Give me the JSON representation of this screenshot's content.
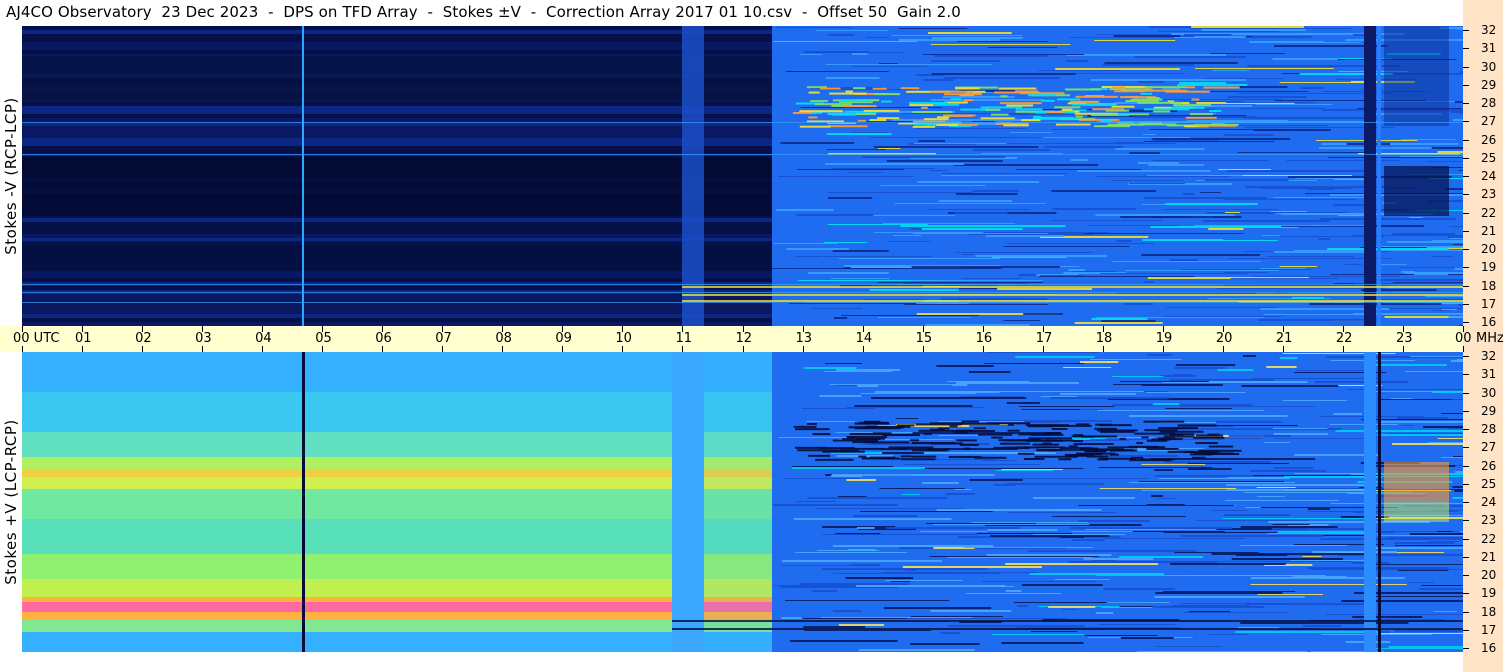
{
  "title": "AJ4CO Observatory  23 Dec 2023  -  DPS on TFD Array  -  Stokes ±V  -  Correction Array 2017 01 10.csv  -  Offset 50  Gain 2.0",
  "panels": {
    "top": {
      "ylabel": "Stokes -V (RCP-LCP)",
      "colormap": "jet-dark"
    },
    "bottom": {
      "ylabel": "Stokes +V (LCP-RCP)",
      "colormap": "jet-bright"
    }
  },
  "time_axis": {
    "labels": [
      "00 UTC",
      "01",
      "02",
      "03",
      "04",
      "05",
      "06",
      "07",
      "08",
      "09",
      "10",
      "11",
      "12",
      "13",
      "14",
      "15",
      "16",
      "17",
      "18",
      "19",
      "20",
      "21",
      "22",
      "23",
      "00"
    ],
    "unit": "MHz"
  },
  "freq_axis": {
    "labels": [
      "32",
      "31",
      "30",
      "29",
      "28",
      "27",
      "26",
      "25",
      "24",
      "23",
      "22",
      "21",
      "20",
      "19",
      "18",
      "17",
      "16"
    ]
  },
  "colors": {
    "time_strip": "#ffffd0",
    "right_strip": "#ffe4c8",
    "dark_bg": "#050c3a",
    "medium_blue": "#1f6cf0",
    "light_blue": "#3aa0ff",
    "cyan": "#00e0f0",
    "green": "#7ee060",
    "yellow": "#f0e030",
    "orange": "#ff9a30",
    "magenta": "#ff50a0"
  },
  "chart_data": {
    "type": "heatmap",
    "title": "AJ4CO Observatory  23 Dec 2023  -  DPS on TFD Array  -  Stokes ±V  -  Correction Array 2017 01 10.csv  -  Offset 50  Gain 2.0",
    "x_range": [
      "00 UTC",
      "00"
    ],
    "y_range_mhz": [
      16,
      32
    ],
    "grid": false,
    "panels": [
      {
        "name": "Stokes -V (RCP-LCP)"
      },
      {
        "name": "Stokes +V (LCP-RCP)"
      }
    ]
  }
}
